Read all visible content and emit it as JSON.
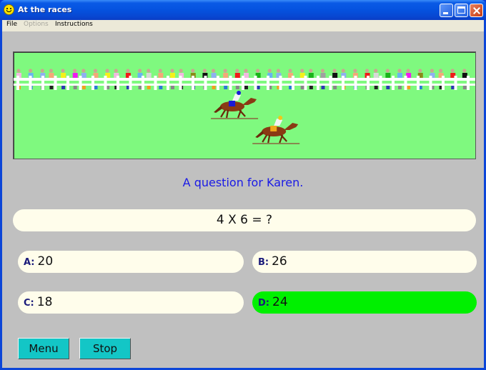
{
  "window": {
    "title": "At the races",
    "title_icon": "smiley-face-icon",
    "controls": [
      "minimize",
      "maximize",
      "close"
    ]
  },
  "menubar": {
    "items": [
      {
        "label": "File",
        "enabled": true
      },
      {
        "label": "Options",
        "enabled": false
      },
      {
        "label": "Instructions",
        "enabled": true
      }
    ]
  },
  "race": {
    "crowd_shirt_colors": [
      "#f2b8e0",
      "#6ab4f0",
      "#8fb0f0",
      "#f4a878",
      "#f4f01a",
      "#f01af0",
      "#8fb0f0",
      "#f4a878",
      "#f4f01a",
      "#f2b8e0",
      "#f01a1a",
      "#6ab4f0",
      "#d8d8d8",
      "#f4a878",
      "#f4f01a",
      "#f2b8e0",
      "#8a8a1a",
      "#111111",
      "#8fb0f0",
      "#f4a878",
      "#f01a1a",
      "#f2b8e0",
      "#1ab41a",
      "#6ab4f0",
      "#8fb0f0",
      "#f4a878",
      "#f4f01a",
      "#1ab41a",
      "#a0a0a0",
      "#111111",
      "#8fb0f0",
      "#f4a878",
      "#f01a1a",
      "#d8d8d8",
      "#1ab41a",
      "#6ab4f0",
      "#f01af0",
      "#8a8a1a",
      "#8fb0f0",
      "#f4a878",
      "#f01a1a",
      "#111111"
    ],
    "horses": [
      {
        "name": "horse-1",
        "saddle_color": "#1a1ad6",
        "cap_color": "#1a1ad6",
        "progress": 0.48
      },
      {
        "name": "horse-2",
        "saddle_color": "#f0a81a",
        "cap_color": "#f0c81a",
        "progress": 0.57
      }
    ]
  },
  "prompt": "A question for Karen.",
  "question": "4 X 6 = ?",
  "answers": [
    {
      "letter": "A:",
      "value": "20",
      "correct": false
    },
    {
      "letter": "B:",
      "value": "26",
      "correct": false
    },
    {
      "letter": "C:",
      "value": "18",
      "correct": false
    },
    {
      "letter": "D:",
      "value": "24",
      "correct": true
    }
  ],
  "buttons": {
    "menu": "Menu",
    "stop": "Stop"
  },
  "colors": {
    "track": "#7ff97f",
    "correct_answer": "#00f000",
    "button": "#13c6c6",
    "prompt_text": "#1a1ae6"
  }
}
